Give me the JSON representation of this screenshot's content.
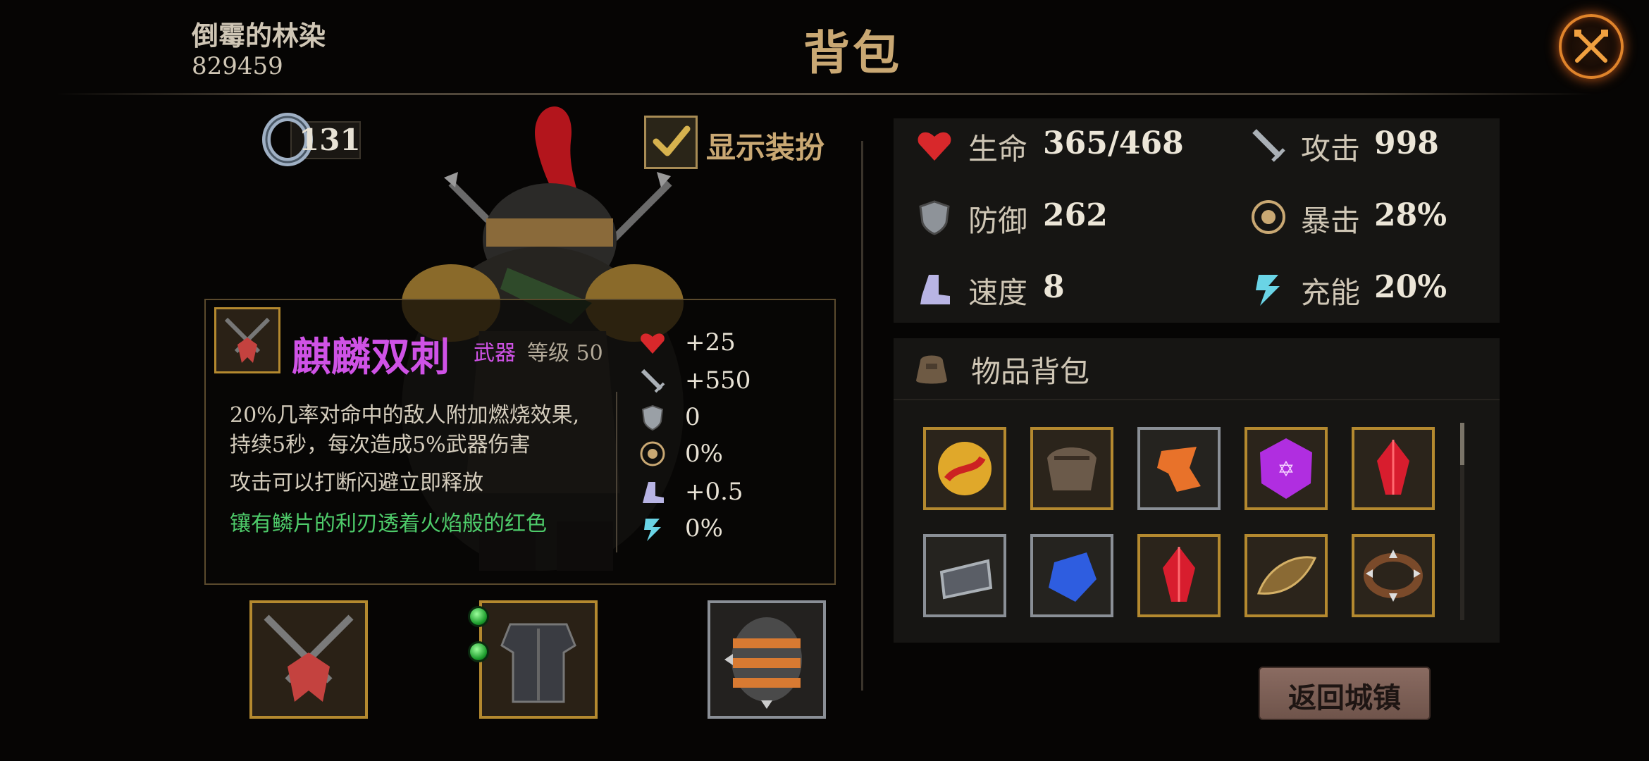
{
  "header": {
    "player_name": "倒霉的林染",
    "player_id": "829459",
    "title": "背包"
  },
  "character": {
    "currency_value": "131",
    "show_outfit_label": "显示装扮",
    "show_outfit_checked": true
  },
  "item_tooltip": {
    "name": "麒麟双刺",
    "type": "武器",
    "level": "等级 50",
    "desc_line1": "20%几率对命中的敌人附加燃烧效果,",
    "desc_line2": "持续5秒，每次造成5%武器伤害",
    "desc_line3": "攻击可以打断闪避立即释放",
    "flavor": "镶有鳞片的利刃透着火焰般的红色",
    "stats": [
      {
        "icon": "heart-icon",
        "value": "+25"
      },
      {
        "icon": "sword-icon",
        "value": "+550"
      },
      {
        "icon": "shield-icon",
        "value": "0"
      },
      {
        "icon": "crit-icon",
        "value": "0%"
      },
      {
        "icon": "boot-icon",
        "value": "+0.5"
      },
      {
        "icon": "energy-icon",
        "value": "0%"
      }
    ]
  },
  "equipment": [
    {
      "name": "weapon",
      "icon": "twin-blades-icon"
    },
    {
      "name": "armor",
      "icon": "armor-icon",
      "gems": 2
    },
    {
      "name": "accessory",
      "icon": "spiked-drum-icon"
    }
  ],
  "stats_panel": {
    "life_label": "生命",
    "life_value": "365/468",
    "attack_label": "攻击",
    "attack_value": "998",
    "defense_label": "防御",
    "defense_value": "262",
    "crit_label": "暴击",
    "crit_value": "28%",
    "speed_label": "速度",
    "speed_value": "8",
    "energy_label": "充能",
    "energy_value": "20%"
  },
  "inventory": {
    "title": "物品背包",
    "items": [
      {
        "icon": "golden-orb-icon",
        "frame": "gold"
      },
      {
        "icon": "pauldron-icon",
        "frame": "gold"
      },
      {
        "icon": "orange-shard-icon",
        "frame": "silver"
      },
      {
        "icon": "purple-rune-gem-icon",
        "frame": "gold"
      },
      {
        "icon": "red-crystal-icon",
        "frame": "gold"
      },
      {
        "icon": "silver-ring-icon",
        "frame": "silver"
      },
      {
        "icon": "blue-gem-icon",
        "frame": "silver"
      },
      {
        "icon": "red-crystal-icon",
        "frame": "gold"
      },
      {
        "icon": "golden-fish-icon",
        "frame": "gold"
      },
      {
        "icon": "spiked-collar-icon",
        "frame": "gold"
      }
    ]
  },
  "return_button": "返回城镇",
  "colors": {
    "title_gold": "#c9a873",
    "legendary_purple": "#cf52e6",
    "flavor_green": "#4ecb6a",
    "frame_gold": "#b4892f",
    "frame_silver": "#8a8f96"
  }
}
